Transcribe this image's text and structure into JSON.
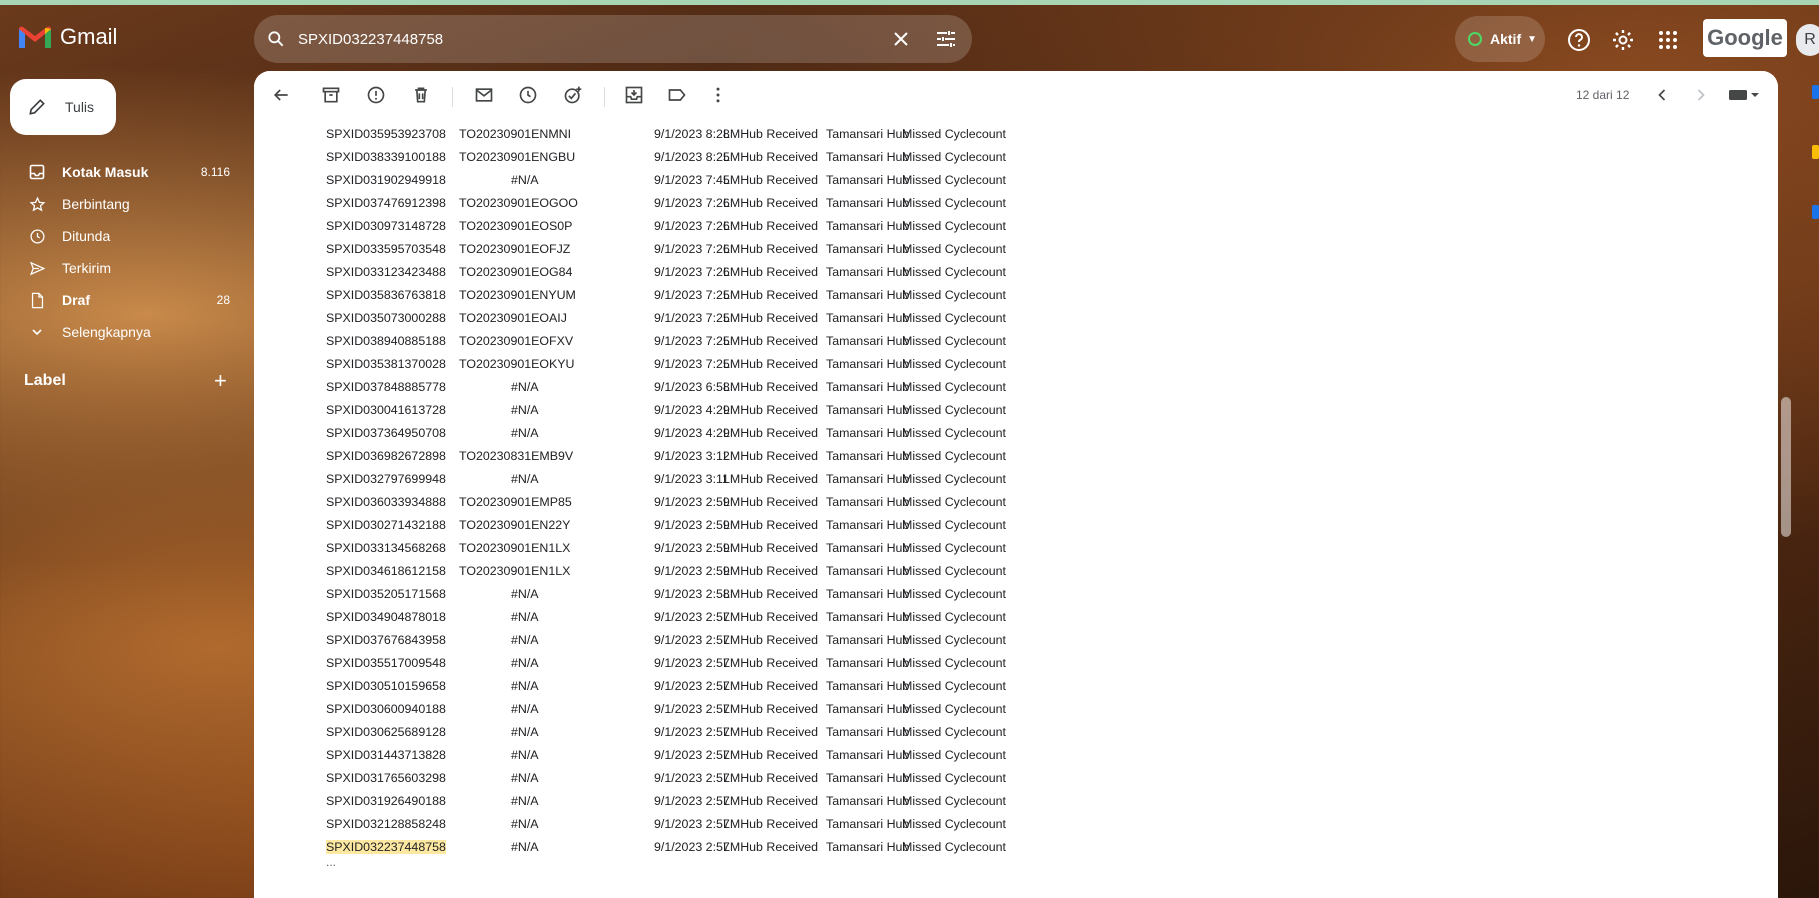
{
  "app": {
    "name": "Gmail"
  },
  "search": {
    "value": "SPXID032237448758"
  },
  "header": {
    "status_label": "Aktif",
    "brand_badge": "Google",
    "avatar_initial": "R"
  },
  "compose": {
    "label": "Tulis"
  },
  "sidebar": {
    "items": [
      {
        "label": "Kotak Masuk",
        "count": "8.116",
        "icon": "inbox-icon"
      },
      {
        "label": "Berbintang",
        "count": "",
        "icon": "star-icon"
      },
      {
        "label": "Ditunda",
        "count": "",
        "icon": "clock-icon"
      },
      {
        "label": "Terkirim",
        "count": "",
        "icon": "send-icon"
      },
      {
        "label": "Draf",
        "count": "28",
        "icon": "draft-icon"
      },
      {
        "label": "Selengkapnya",
        "count": "",
        "icon": "chevron-down-icon"
      }
    ],
    "label_header": "Label",
    "label_add": "+"
  },
  "toolbar": {
    "pager_text": "12 dari 12"
  },
  "rows": [
    [
      "SPXID035953923708",
      "TO20230901ENMNI",
      "9/1/2023 8:28",
      "LMHub Received",
      "Tamansari Hub",
      "Missed Cyclecount"
    ],
    [
      "SPXID038339100188",
      "TO20230901ENGBU",
      "9/1/2023 8:25",
      "LMHub Received",
      "Tamansari Hub",
      "Missed Cyclecount"
    ],
    [
      "SPXID031902949918",
      "#N/A",
      "9/1/2023 7:45",
      "LMHub Received",
      "Tamansari Hub",
      "Missed Cyclecount"
    ],
    [
      "SPXID037476912398",
      "TO20230901EOGOO",
      "9/1/2023 7:26",
      "LMHub Received",
      "Tamansari Hub",
      "Missed Cyclecount"
    ],
    [
      "SPXID030973148728",
      "TO20230901EOS0P",
      "9/1/2023 7:26",
      "LMHub Received",
      "Tamansari Hub",
      "Missed Cyclecount"
    ],
    [
      "SPXID033595703548",
      "TO20230901EOFJZ",
      "9/1/2023 7:26",
      "LMHub Received",
      "Tamansari Hub",
      "Missed Cyclecount"
    ],
    [
      "SPXID033123423488",
      "TO20230901EOG84",
      "9/1/2023 7:26",
      "LMHub Received",
      "Tamansari Hub",
      "Missed Cyclecount"
    ],
    [
      "SPXID035836763818",
      "TO20230901ENYUM",
      "9/1/2023 7:25",
      "LMHub Received",
      "Tamansari Hub",
      "Missed Cyclecount"
    ],
    [
      "SPXID035073000288",
      "TO20230901EOAIJ",
      "9/1/2023 7:25",
      "LMHub Received",
      "Tamansari Hub",
      "Missed Cyclecount"
    ],
    [
      "SPXID038940885188",
      "TO20230901EOFXV",
      "9/1/2023 7:25",
      "LMHub Received",
      "Tamansari Hub",
      "Missed Cyclecount"
    ],
    [
      "SPXID035381370028",
      "TO20230901EOKYU",
      "9/1/2023 7:25",
      "LMHub Received",
      "Tamansari Hub",
      "Missed Cyclecount"
    ],
    [
      "SPXID037848885778",
      "#N/A",
      "9/1/2023 6:58",
      "LMHub Received",
      "Tamansari Hub",
      "Missed Cyclecount"
    ],
    [
      "SPXID030041613728",
      "#N/A",
      "9/1/2023 4:29",
      "LMHub Received",
      "Tamansari Hub",
      "Missed Cyclecount"
    ],
    [
      "SPXID037364950708",
      "#N/A",
      "9/1/2023 4:29",
      "LMHub Received",
      "Tamansari Hub",
      "Missed Cyclecount"
    ],
    [
      "SPXID036982672898",
      "TO20230831EMB9V",
      "9/1/2023 3:12",
      "LMHub Received",
      "Tamansari Hub",
      "Missed Cyclecount"
    ],
    [
      "SPXID032797699948",
      "#N/A",
      "9/1/2023 3:11",
      "LMHub Received",
      "Tamansari Hub",
      "Missed Cyclecount"
    ],
    [
      "SPXID036033934888",
      "TO20230901EMP85",
      "9/1/2023 2:59",
      "LMHub Received",
      "Tamansari Hub",
      "Missed Cyclecount"
    ],
    [
      "SPXID030271432188",
      "TO20230901EN22Y",
      "9/1/2023 2:59",
      "LMHub Received",
      "Tamansari Hub",
      "Missed Cyclecount"
    ],
    [
      "SPXID033134568268",
      "TO20230901EN1LX",
      "9/1/2023 2:59",
      "LMHub Received",
      "Tamansari Hub",
      "Missed Cyclecount"
    ],
    [
      "SPXID034618612158",
      "TO20230901EN1LX",
      "9/1/2023 2:59",
      "LMHub Received",
      "Tamansari Hub",
      "Missed Cyclecount"
    ],
    [
      "SPXID035205171568",
      "#N/A",
      "9/1/2023 2:58",
      "LMHub Received",
      "Tamansari Hub",
      "Missed Cyclecount"
    ],
    [
      "SPXID034904878018",
      "#N/A",
      "9/1/2023 2:57",
      "LMHub Received",
      "Tamansari Hub",
      "Missed Cyclecount"
    ],
    [
      "SPXID037676843958",
      "#N/A",
      "9/1/2023 2:57",
      "LMHub Received",
      "Tamansari Hub",
      "Missed Cyclecount"
    ],
    [
      "SPXID035517009548",
      "#N/A",
      "9/1/2023 2:57",
      "LMHub Received",
      "Tamansari Hub",
      "Missed Cyclecount"
    ],
    [
      "SPXID030510159658",
      "#N/A",
      "9/1/2023 2:57",
      "LMHub Received",
      "Tamansari Hub",
      "Missed Cyclecount"
    ],
    [
      "SPXID030600940188",
      "#N/A",
      "9/1/2023 2:57",
      "LMHub Received",
      "Tamansari Hub",
      "Missed Cyclecount"
    ],
    [
      "SPXID030625689128",
      "#N/A",
      "9/1/2023 2:57",
      "LMHub Received",
      "Tamansari Hub",
      "Missed Cyclecount"
    ],
    [
      "SPXID031443713828",
      "#N/A",
      "9/1/2023 2:57",
      "LMHub Received",
      "Tamansari Hub",
      "Missed Cyclecount"
    ],
    [
      "SPXID031765603298",
      "#N/A",
      "9/1/2023 2:57",
      "LMHub Received",
      "Tamansari Hub",
      "Missed Cyclecount"
    ],
    [
      "SPXID031926490188",
      "#N/A",
      "9/1/2023 2:57",
      "LMHub Received",
      "Tamansari Hub",
      "Missed Cyclecount"
    ],
    [
      "SPXID032128858248",
      "#N/A",
      "9/1/2023 2:57",
      "LMHub Received",
      "Tamansari Hub",
      "Missed Cyclecount"
    ],
    [
      "SPXID032237448758",
      "#N/A",
      "9/1/2023 2:57",
      "LMHub Received",
      "Tamansari Hub",
      "Missed Cyclecount"
    ]
  ],
  "highlight_term": "SPXID032237448758",
  "trailing": "...",
  "colors": {
    "highlight": "#fce8a0",
    "status_green": "#4cd964",
    "gmail_red": "#ea4335"
  }
}
